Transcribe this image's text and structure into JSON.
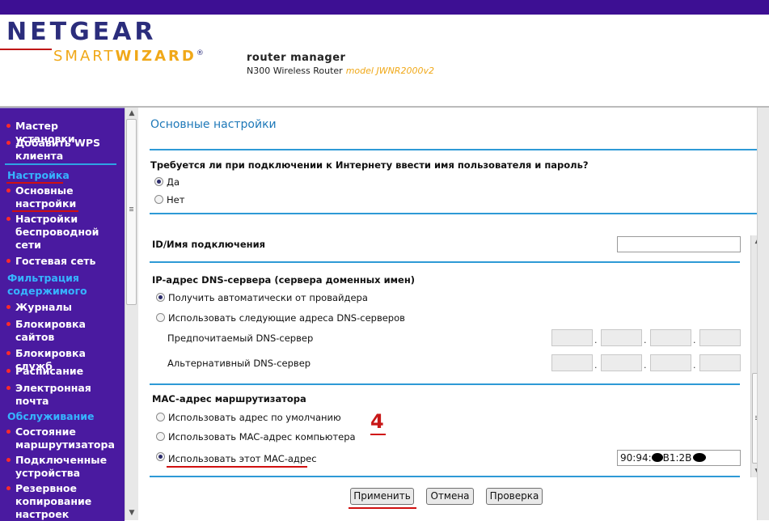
{
  "header": {
    "brand": "NETGEAR",
    "smart": "SMART",
    "wizard": "WIZARD",
    "reg": "®",
    "tagline": "router manager",
    "product": "N300 Wireless Router",
    "model": "model JWNR2000v2"
  },
  "sidebar": {
    "items": [
      {
        "label": "Мастер установки"
      },
      {
        "label": "Добавить WPS клиента"
      },
      {
        "label": "Основные настройки"
      },
      {
        "label": "Настройки беспроводной сети"
      },
      {
        "label": "Гостевая сеть"
      },
      {
        "label": "Журналы"
      },
      {
        "label": "Блокировка сайтов"
      },
      {
        "label": "Блокировка служб"
      },
      {
        "label": "Расписание"
      },
      {
        "label": "Электронная почта"
      },
      {
        "label": "Состояние маршрутизатора"
      },
      {
        "label": "Подключенные устройства"
      },
      {
        "label": "Резервное копирование настроек"
      }
    ],
    "headings": {
      "settings": "Настройка",
      "filter": "Фильтрация содержимого",
      "service": "Обслуживание"
    }
  },
  "main": {
    "title": "Основные настройки",
    "login_question": "Требуется ли при подключении к Интернету ввести имя пользователя и пароль?",
    "yes": "Да",
    "no": "Нет",
    "conn_id_label": "ID/Имя подключения",
    "conn_id_value": "",
    "dns_title": "IP-адрес DNS-сервера (сервера доменных имен)",
    "dns_auto": "Получить автоматически от провайдера",
    "dns_manual": "Использовать следующие адреса DNS-серверов",
    "dns_primary": "Предпочитаемый DNS-сервер",
    "dns_secondary": "Альтернативный DNS-сервер",
    "dot": ".",
    "mac_title": "MAC-адрес маршрутизатора",
    "mac_default": "Использовать адрес по умолчанию",
    "mac_computer": "Использовать MAC-адрес компьютера",
    "mac_this": "Использовать этот MAC-адрес",
    "mac_value_a": "90:94:",
    "mac_value_b": "B1:2B",
    "annotation": "4"
  },
  "buttons": {
    "apply": "Применить",
    "cancel": "Отмена",
    "check": "Проверка"
  },
  "selection": {
    "login_required": "yes",
    "dns": "auto",
    "mac": "this"
  },
  "colors": {
    "topbar": "#3d0f93",
    "sidebar": "#4a1aa0",
    "sidebar_heading": "#36b4ff",
    "accent_line": "#2e9ad6",
    "title": "#1d78b8",
    "annotation": "#c81818"
  }
}
